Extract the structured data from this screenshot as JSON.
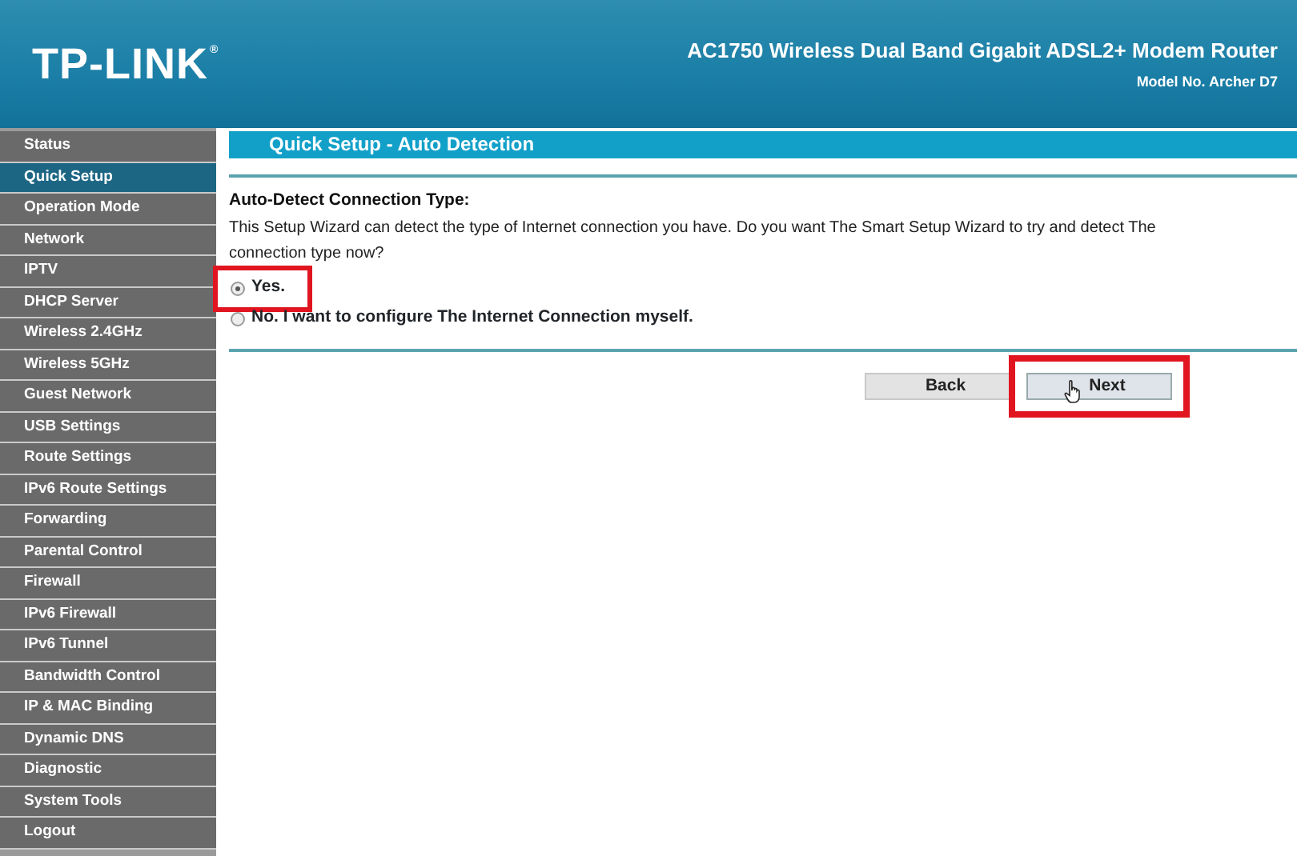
{
  "header": {
    "logo": "TP-LINK",
    "logo_mark": "®",
    "product": "AC1750 Wireless Dual Band Gigabit ADSL2+ Modem Router",
    "model": "Model No. Archer D7"
  },
  "sidebar": {
    "items": [
      {
        "label": "Status",
        "selected": false
      },
      {
        "label": "Quick Setup",
        "selected": true
      },
      {
        "label": "Operation Mode",
        "selected": false
      },
      {
        "label": "Network",
        "selected": false
      },
      {
        "label": "IPTV",
        "selected": false
      },
      {
        "label": "DHCP Server",
        "selected": false
      },
      {
        "label": "Wireless 2.4GHz",
        "selected": false
      },
      {
        "label": "Wireless 5GHz",
        "selected": false
      },
      {
        "label": "Guest Network",
        "selected": false
      },
      {
        "label": "USB Settings",
        "selected": false
      },
      {
        "label": "Route Settings",
        "selected": false
      },
      {
        "label": "IPv6 Route Settings",
        "selected": false
      },
      {
        "label": "Forwarding",
        "selected": false
      },
      {
        "label": "Parental Control",
        "selected": false
      },
      {
        "label": "Firewall",
        "selected": false
      },
      {
        "label": "IPv6 Firewall",
        "selected": false
      },
      {
        "label": "IPv6 Tunnel",
        "selected": false
      },
      {
        "label": "Bandwidth Control",
        "selected": false
      },
      {
        "label": "IP & MAC Binding",
        "selected": false
      },
      {
        "label": "Dynamic DNS",
        "selected": false
      },
      {
        "label": "Diagnostic",
        "selected": false
      },
      {
        "label": "System Tools",
        "selected": false
      },
      {
        "label": "Logout",
        "selected": false
      }
    ]
  },
  "main": {
    "title": "Quick Setup - Auto Detection",
    "heading": "Auto-Detect Connection Type:",
    "description": "This Setup Wizard can detect the type of Internet connection you have. Do you want The Smart Setup Wizard to try and detect The connection type now?",
    "options": [
      {
        "label": "Yes.",
        "selected": true,
        "highlighted": true
      },
      {
        "label": "No. I want to configure The Internet Connection myself.",
        "selected": false,
        "highlighted": false
      }
    ],
    "buttons": [
      {
        "label": "Back",
        "highlighted": false,
        "pointer": false
      },
      {
        "label": "Next",
        "highlighted": true,
        "pointer": true
      }
    ]
  }
}
